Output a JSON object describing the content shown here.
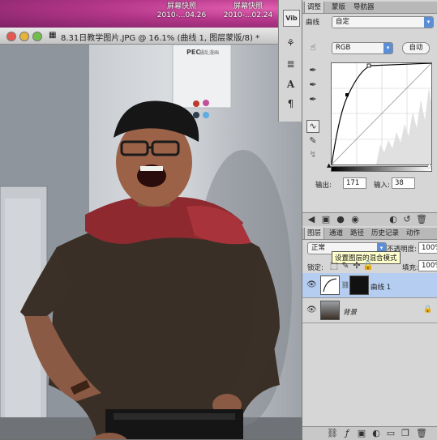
{
  "desktop": {
    "snapshots": [
      {
        "label": "屏幕快照",
        "date": "2010-...04.26"
      },
      {
        "label": "屏幕快照",
        "date": "2010-...02.24"
      }
    ]
  },
  "document": {
    "title": "8.31日教学图片.JPG @ 16.1% (曲线 1, 图层蒙版/8) *"
  },
  "poster": {
    "text1": "PEC",
    "text2": "骚乱漫画"
  },
  "toolbar": {
    "vib_label": "Vib"
  },
  "adjust_panel": {
    "tabs": [
      "调整",
      "蒙版",
      "导航器"
    ],
    "curve_label": "曲线",
    "preset_value": "自定",
    "channel_value": "RGB",
    "auto_button": "自动",
    "output_label": "输出:",
    "output_value": "171",
    "input_label": "输入:",
    "input_value": "38"
  },
  "layers_panel": {
    "tabs": [
      "图层",
      "通道",
      "路径",
      "历史记录",
      "动作"
    ],
    "blend_mode": "正常",
    "opacity_label": "不透明度:",
    "opacity_value": "100%",
    "lock_label": "锁定:",
    "fill_label": "填充:",
    "fill_value": "100%",
    "tooltip": "设置图层的混合模式",
    "layers": [
      {
        "name": "曲线 1",
        "selected": true
      },
      {
        "name": "背景",
        "selected": false
      }
    ]
  },
  "colors": {
    "accent": "#5b8ed6",
    "selected_layer": "#b4cdf0"
  }
}
